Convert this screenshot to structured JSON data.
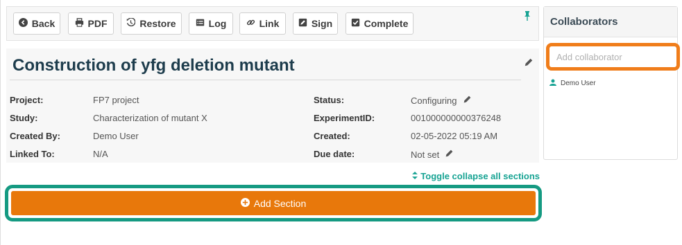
{
  "toolbar": {
    "buttons": [
      {
        "label": "Back",
        "icon": "back-circle-icon"
      },
      {
        "label": "PDF",
        "icon": "printer-icon"
      },
      {
        "label": "Restore",
        "icon": "history-icon"
      },
      {
        "label": "Log",
        "icon": "list-icon"
      },
      {
        "label": "Link",
        "icon": "link-icon"
      },
      {
        "label": "Sign",
        "icon": "signature-icon"
      },
      {
        "label": "Complete",
        "icon": "check-square-icon"
      }
    ],
    "pin_icon": "pin-icon"
  },
  "experiment": {
    "title": "Construction of yfg deletion mutant",
    "fields_left": [
      {
        "label": "Project:",
        "value": "FP7 project"
      },
      {
        "label": "Study:",
        "value": "Characterization of mutant X"
      },
      {
        "label": "Created By:",
        "value": "Demo User"
      },
      {
        "label": "Linked To:",
        "value": "N/A"
      }
    ],
    "fields_right": [
      {
        "label": "Status:",
        "value": "Configuring"
      },
      {
        "label": "ExperimentID:",
        "value": "001000000000376248"
      },
      {
        "label": "Created:",
        "value": "02-05-2022 05:19 AM"
      },
      {
        "label": "Due date:",
        "value": "Not set"
      }
    ]
  },
  "toggle_label": "Toggle collapse all sections",
  "add_section_label": "Add Section",
  "collaborators": {
    "title": "Collaborators",
    "input_placeholder": "Add collaborator",
    "users": [
      "Demo User"
    ]
  },
  "colors": {
    "accent_teal": "#17a393",
    "highlight_teal": "#159a82",
    "orange": "#e8780b",
    "highlight_orange": "#f07d1a",
    "title_navy": "#1d3c4c"
  }
}
